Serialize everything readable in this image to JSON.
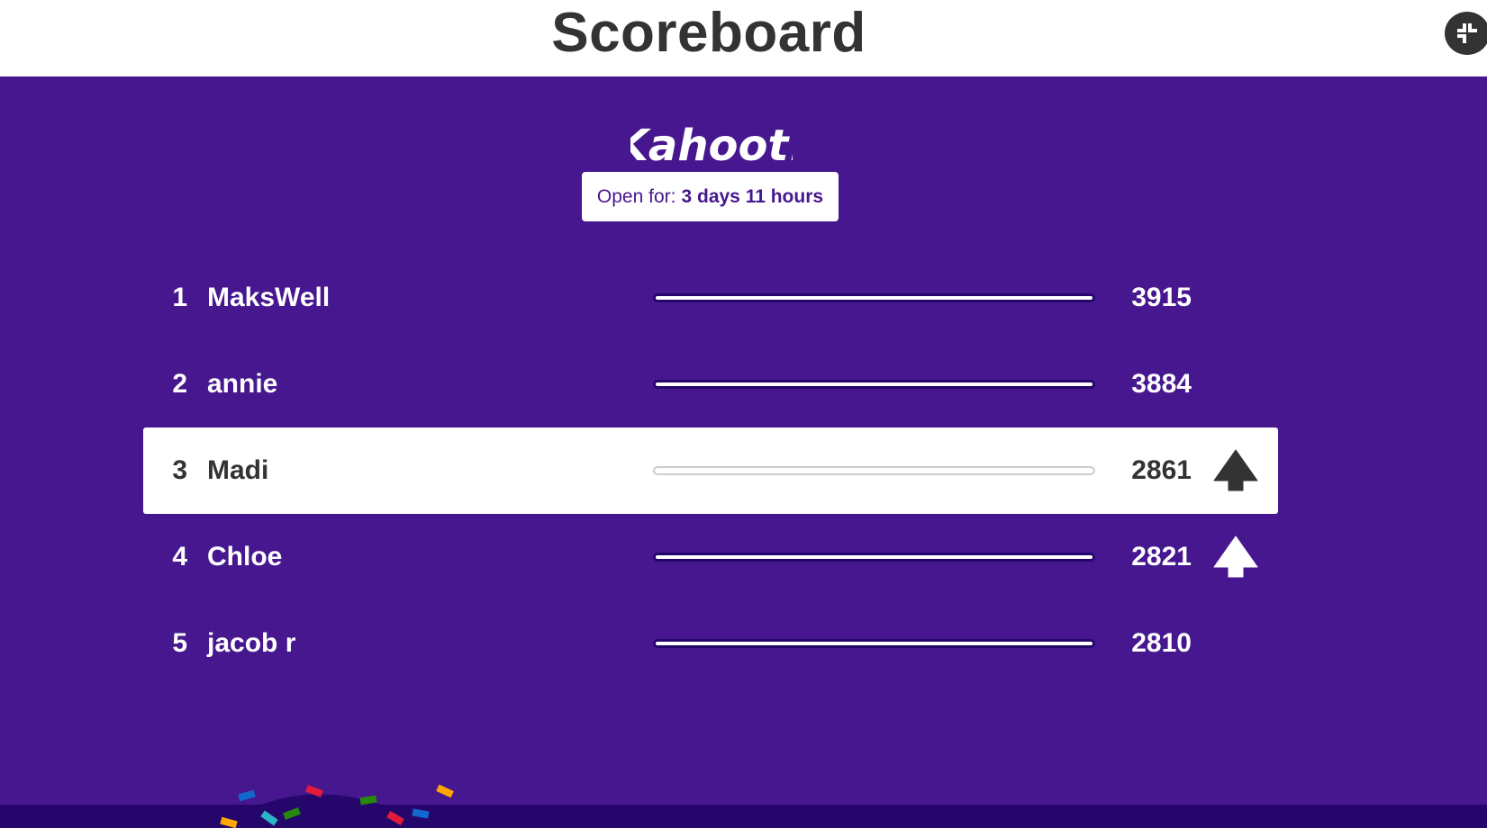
{
  "header": {
    "title": "Scoreboard"
  },
  "fullscreen": {
    "icon": "exit-fullscreen-icon"
  },
  "brand": {
    "logo_text": "Kahoot!"
  },
  "status": {
    "open_label": "Open for:",
    "open_value": "3 days 11 hours"
  },
  "scoreboard": {
    "rows": [
      {
        "rank": "1",
        "name": "MaksWell",
        "score": "3915",
        "highlight": false,
        "movement": "none"
      },
      {
        "rank": "2",
        "name": "annie",
        "score": "3884",
        "highlight": false,
        "movement": "none"
      },
      {
        "rank": "3",
        "name": "Madi",
        "score": "2861",
        "highlight": true,
        "movement": "up"
      },
      {
        "rank": "4",
        "name": "Chloe",
        "score": "2821",
        "highlight": false,
        "movement": "up"
      },
      {
        "rank": "5",
        "name": "jacob r",
        "score": "2810",
        "highlight": false,
        "movement": "none"
      }
    ]
  },
  "colors": {
    "background": "#46178f",
    "footer": "#25076b",
    "topbar": "#ffffff",
    "text_dark": "#333333"
  }
}
